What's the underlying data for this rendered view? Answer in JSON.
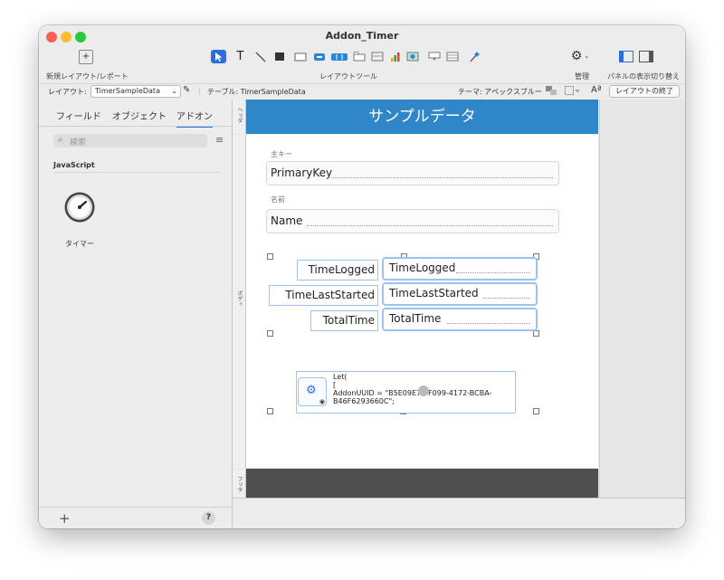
{
  "window": {
    "title": "Addon_Timer"
  },
  "toolbar": {
    "new_layout_label": "新規レイアウト/レポート",
    "layout_tools_label": "レイアウトツール",
    "manage_label": "管理",
    "panel_toggle_label": "パネルの表示切り替え"
  },
  "infobar": {
    "layout_prefix": "レイアウト:",
    "layout_name": "TimerSampleData",
    "table_label": "テーブル: TimerSampleData",
    "theme_label": "テーマ: アペックスブルー",
    "exit_layout_button": "レイアウトの終了"
  },
  "sidebar": {
    "tabs": [
      "フィールド",
      "オブジェクト",
      "アドオン"
    ],
    "active_tab": "アドオン",
    "search_placeholder": "検索",
    "section_title": "JavaScript",
    "addon_item_label": "タイマー",
    "add_button": "+",
    "help_button": "?"
  },
  "canvas": {
    "part_labels": {
      "header": "ヘッダ",
      "body": "ボディ",
      "footer": "フッタ"
    },
    "header_title": "サンプルデータ",
    "fields": [
      {
        "label": "主キー",
        "value": "PrimaryKey"
      },
      {
        "label": "名前",
        "value": "Name"
      }
    ],
    "bound_fields": [
      {
        "label": "TimeLogged",
        "value": "TimeLogged"
      },
      {
        "label": "TimeLastStarted",
        "value": "TimeLastStarted"
      },
      {
        "label": "TotalTime",
        "value": "TotalTime"
      }
    ],
    "webviewer_code": [
      "Let(",
      "[",
      "AddonUUID = \"B5E09E7E-F099-4172-BCBA-",
      "B46F6293660C\";"
    ]
  },
  "colors": {
    "accent": "#2a6fde",
    "header_bg": "#2f86c9",
    "footer_bg": "#4f4f4f",
    "selection_border": "#9fc3ec"
  }
}
